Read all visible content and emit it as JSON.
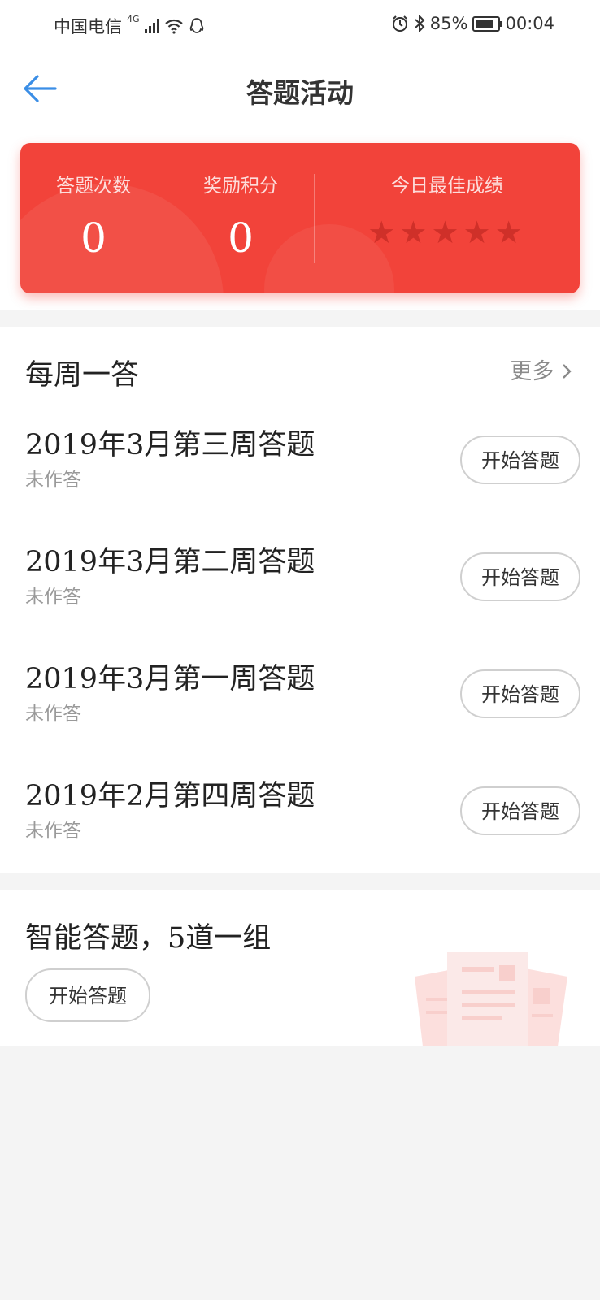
{
  "status_bar": {
    "carrier": "中国电信",
    "network": "4G",
    "battery": "85%",
    "time": "00:04"
  },
  "header": {
    "title": "答题活动"
  },
  "stats": {
    "attempts_label": "答题次数",
    "attempts_value": "0",
    "points_label": "奖励积分",
    "points_value": "0",
    "best_label": "今日最佳成绩",
    "best_stars": 0,
    "best_stars_max": 5
  },
  "weekly": {
    "title": "每周一答",
    "more_label": "更多",
    "items": [
      {
        "title": "2019年3月第三周答题",
        "status": "未作答",
        "button": "开始答题"
      },
      {
        "title": "2019年3月第二周答题",
        "status": "未作答",
        "button": "开始答题"
      },
      {
        "title": "2019年3月第一周答题",
        "status": "未作答",
        "button": "开始答题"
      },
      {
        "title": "2019年2月第四周答题",
        "status": "未作答",
        "button": "开始答题"
      }
    ]
  },
  "smart": {
    "title": "智能答题，5道一组",
    "button": "开始答题"
  },
  "colors": {
    "accent_red": "#f2433a",
    "back_arrow_blue": "#3a8ee6"
  }
}
